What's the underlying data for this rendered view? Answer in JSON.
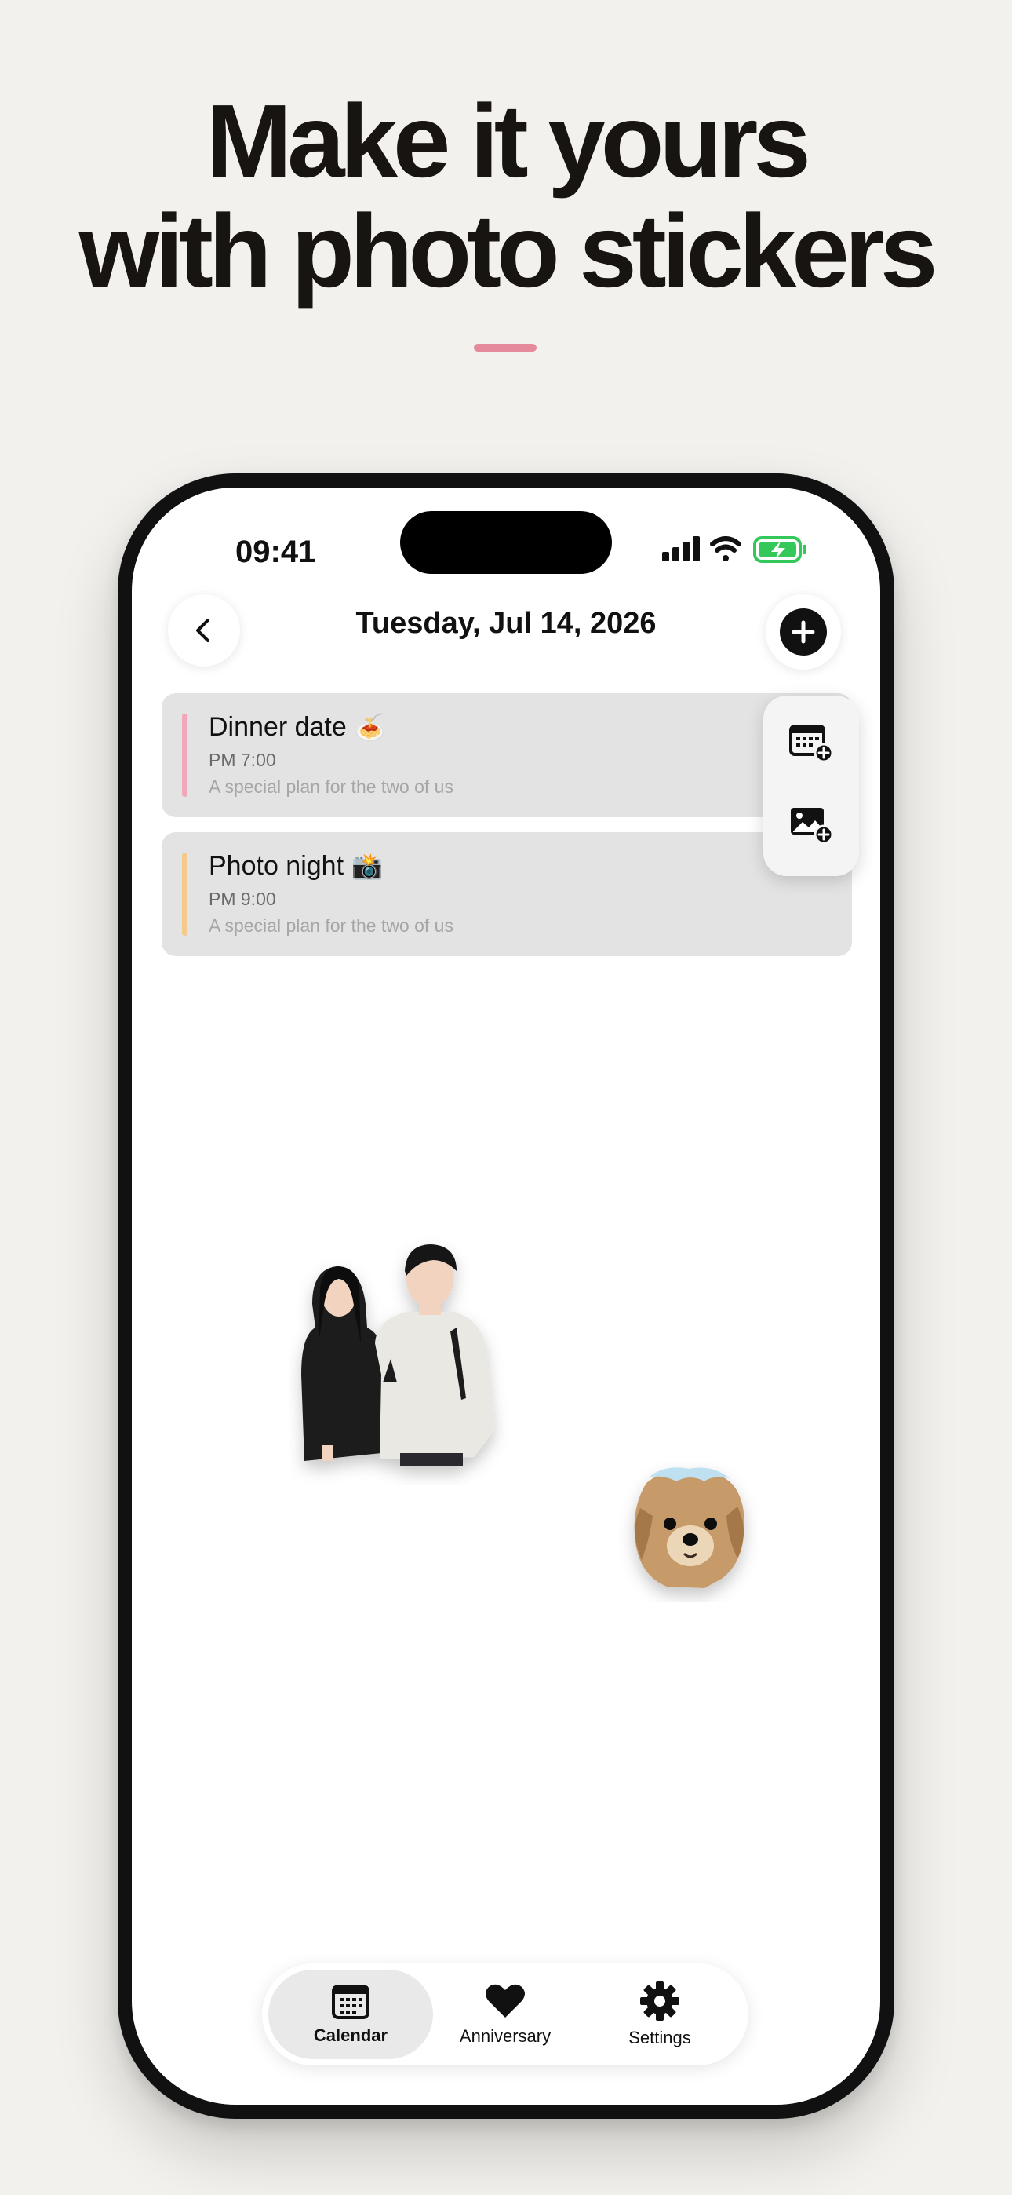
{
  "headline": {
    "line1": "Make it yours",
    "line2": "with photo stickers"
  },
  "status_bar": {
    "time": "09:41"
  },
  "nav": {
    "title": "Tuesday, Jul 14, 2026",
    "back_icon": "chevron-left-icon",
    "add_icon": "plus-icon"
  },
  "events": [
    {
      "title": "Dinner date",
      "emoji": "🍝",
      "time": "PM 7:00",
      "description": "A special plan for the two of us",
      "color": "#f2a7b8"
    },
    {
      "title": "Photo night",
      "emoji": "📸",
      "time": "PM 9:00",
      "description": "A special plan for the two of us",
      "color": "#f6c98a"
    }
  ],
  "add_menu": {
    "items": [
      "add-calendar-event-icon",
      "add-photo-icon"
    ]
  },
  "stickers": [
    "couple-photo-sticker",
    "dog-photo-sticker"
  ],
  "tabbar": {
    "tabs": [
      {
        "label": "Calendar",
        "icon": "calendar-icon",
        "active": true
      },
      {
        "label": "Anniversary",
        "icon": "heart-icon",
        "active": false
      },
      {
        "label": "Settings",
        "icon": "gear-icon",
        "active": false
      }
    ]
  },
  "colors": {
    "background": "#f3f1ed",
    "accent": "#e58a9c",
    "battery": "#34c759"
  }
}
